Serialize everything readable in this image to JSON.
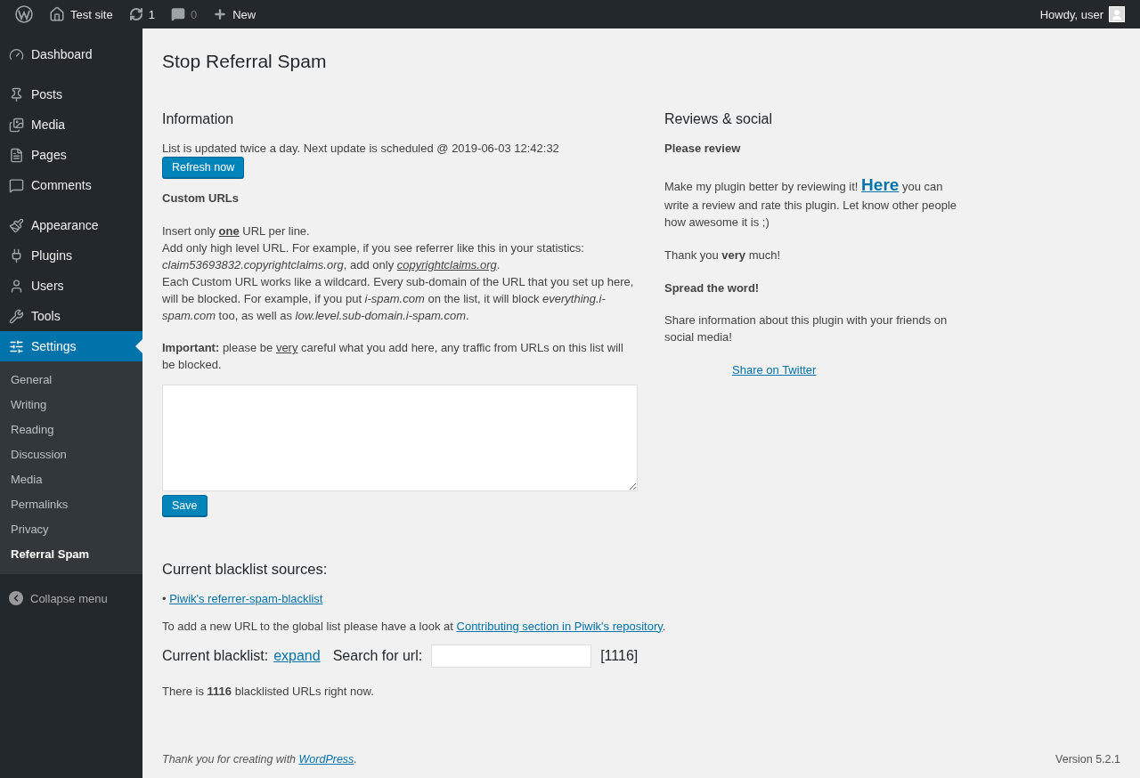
{
  "admin_bar": {
    "site": "Test site",
    "updates": "1",
    "comments": "0",
    "new": "New",
    "greeting": "Howdy, user"
  },
  "sidebar": {
    "groups": [
      [
        {
          "label": "Dashboard",
          "selected": false
        }
      ],
      [
        {
          "label": "Posts",
          "selected": false
        },
        {
          "label": "Media",
          "selected": false
        },
        {
          "label": "Pages",
          "selected": false
        },
        {
          "label": "Comments",
          "selected": false
        }
      ],
      [
        {
          "label": "Appearance",
          "selected": false
        },
        {
          "label": "Plugins",
          "selected": false
        },
        {
          "label": "Users",
          "selected": false
        },
        {
          "label": "Tools",
          "selected": false
        },
        {
          "label": "Settings",
          "selected": true,
          "children": [
            {
              "label": "General",
              "selected": false
            },
            {
              "label": "Writing",
              "selected": false
            },
            {
              "label": "Reading",
              "selected": false
            },
            {
              "label": "Discussion",
              "selected": false
            },
            {
              "label": "Media",
              "selected": false
            },
            {
              "label": "Permalinks",
              "selected": false
            },
            {
              "label": "Privacy",
              "selected": false
            },
            {
              "label": "Referral Spam",
              "selected": true
            }
          ]
        }
      ]
    ],
    "collapse": "Collapse menu"
  },
  "page_title": "Stop Referral Spam",
  "information": {
    "heading": "Information",
    "schedule": "List is updated twice a day. Next update is scheduled @ 2019-06-03 12:42:32",
    "refresh_button": "Refresh now",
    "custom_heading": "Custom URLs",
    "paragraphs": [
      [
        [
          {
            "kind": "text",
            "text": "Insert only "
          },
          {
            "kind": "underlined",
            "text": "**one**"
          },
          {
            "kind": "text",
            "text": " URL per line."
          }
        ],
        [
          {
            "kind": "text",
            "text": "Add only high level URL. For example, if you see referrer like this in your statistics: *claim53693832.copyrightclaims.org*, add only "
          },
          {
            "kind": "underlined",
            "text": "*copyrightclaims.org*"
          },
          {
            "kind": "text",
            "text": "."
          }
        ],
        [
          {
            "kind": "text",
            "text": "Each Custom URL works like a wildcard. Every sub-domain of the URL that you set up here, will be blocked. For example, if you put *i-spam.com* on the list, it will block *everything.i-spam.com* too, as well as *low.level.sub-domain.i-spam.com*."
          }
        ]
      ],
      [
        [
          {
            "kind": "text",
            "text": "**Important:** please be "
          },
          {
            "kind": "underlined",
            "text": "very"
          },
          {
            "kind": "text",
            "text": " careful what you add here, any traffic from URLs on this list will be blocked."
          }
        ]
      ]
    ],
    "save_button": "Save"
  },
  "reviews": {
    "heading": "Reviews & social",
    "blocks": [
      [
        {
          "kind": "text",
          "text": "Please review"
        }
      ],
      [
        {
          "kind": "text",
          "text": "Make my plugin better by reviewing it! "
        },
        {
          "kind": "biglink",
          "text": "Here"
        },
        {
          "kind": "text",
          "text": " you can write a review and rate this plugin. Let know other people how awesome it is ;)"
        }
      ],
      [
        {
          "kind": "text",
          "text": "Thank you **very** much!"
        }
      ],
      [
        {
          "kind": "text",
          "text": "Spread the word!"
        }
      ],
      [
        {
          "kind": "text",
          "text": "Share information about this plugin with your friends on social media!"
        }
      ]
    ],
    "share_link": "Share on Twitter"
  },
  "sources": {
    "heading": "Current blacklist sources:",
    "bullet": "•",
    "link": "Piwik's referrer-spam-blacklist",
    "note": [
      {
        "kind": "text",
        "text": "To add a new URL to the global list please have a look at "
      },
      {
        "kind": "link",
        "text": "Contributing section in Piwik's repository"
      },
      {
        "kind": "text",
        "text": "."
      }
    ]
  },
  "blacklist": {
    "label": "Current blacklist:",
    "expand": "expand",
    "search_label": "Search for url:",
    "count": "[1116]",
    "summary": "There is **1116** blacklisted URLs right now."
  },
  "footer": {
    "thanks": [
      {
        "kind": "text",
        "text": "Thank you for creating with "
      },
      {
        "kind": "link",
        "text": "WordPress"
      },
      {
        "kind": "text",
        "text": "."
      }
    ],
    "version": "Version 5.2.1"
  }
}
